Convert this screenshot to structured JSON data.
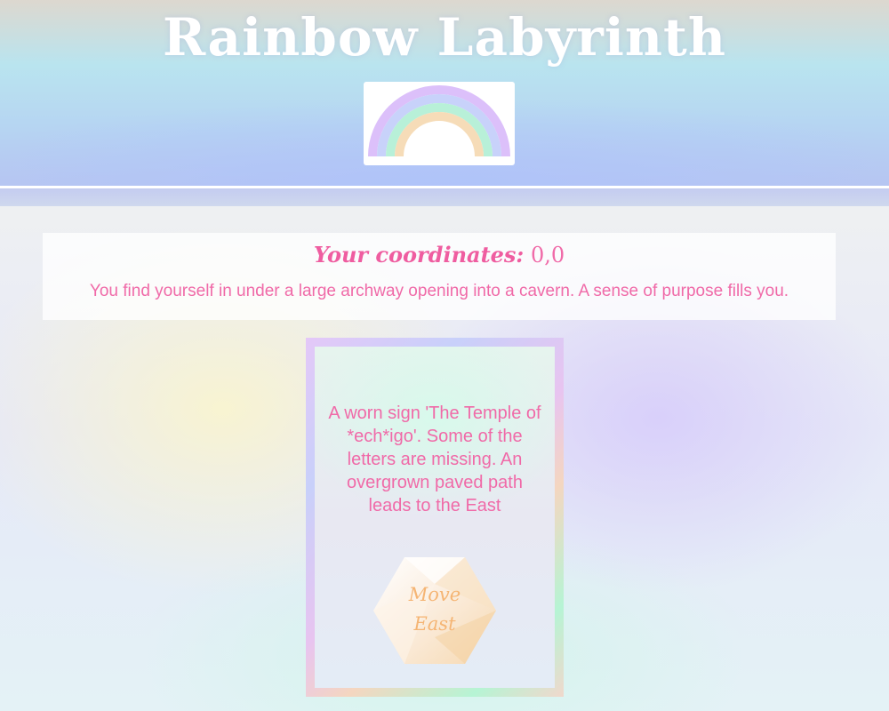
{
  "header": {
    "title": "Rainbow Labyrinth",
    "logo_icon": "rainbow-icon"
  },
  "status": {
    "coords_label": "Your coordinates:",
    "coords_value": "0,0",
    "description": "You find yourself in under a large archway opening into a cavern. A sense of purpose fills you."
  },
  "room": {
    "description": "A worn sign 'The Temple of *ech*igo'. Some of the letters are missing. An overgrown paved path leads to the East",
    "move_button": {
      "label_line1": "Move",
      "label_line2": "East"
    }
  },
  "colors": {
    "accent_pink": "#f06aa8",
    "button_text": "#f5b574",
    "title_text": "#ffffff"
  }
}
